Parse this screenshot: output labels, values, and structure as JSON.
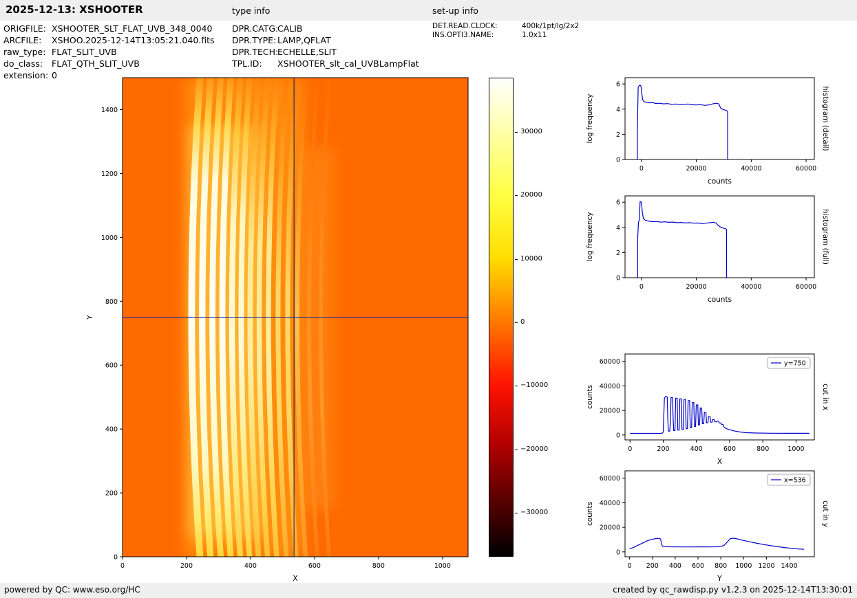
{
  "header": {
    "title": "2025-12-13: XSHOOTER",
    "type_info_label": "type info",
    "setup_info_label": "set-up info"
  },
  "metadata": {
    "left": [
      {
        "label": "ORIGFILE:",
        "value": "XSHOOTER_SLT_FLAT_UVB_348_0040"
      },
      {
        "label": "ARCFILE:",
        "value": "XSHOO.2025-12-14T13:05:21.040.fits"
      },
      {
        "label": "raw_type:",
        "value": "FLAT_SLIT_UVB"
      },
      {
        "label": "do_class:",
        "value": "FLAT_QTH_SLIT_UVB"
      },
      {
        "label": "extension:",
        "value": "0"
      }
    ],
    "middle": [
      {
        "label": "DPR.CATG:",
        "value": "CALIB"
      },
      {
        "label": "DPR.TYPE:",
        "value": "LAMP,QFLAT"
      },
      {
        "label": "DPR.TECH:",
        "value": "ECHELLE,SLIT"
      },
      {
        "label": "TPL.ID:",
        "value": "XSHOOTER_slt_cal_UVBLampFlat"
      }
    ],
    "right": [
      {
        "label": "DET.READ.CLOCK:",
        "value": "400k/1pt/lg/2x2"
      },
      {
        "label": "INS.OPTI3.NAME:",
        "value": "1.0x11"
      }
    ]
  },
  "footer": {
    "left": "powered by QC: www.eso.org/HC",
    "right": "created by qc_rawdisp.py v1.2.3 on 2025-12-14T13:30:01"
  },
  "colorbar": {
    "vmin": -37000,
    "vmax": 38500,
    "ticks": [
      {
        "value": 30000,
        "label": "30000"
      },
      {
        "value": 20000,
        "label": "20000"
      },
      {
        "value": 10000,
        "label": "10000"
      },
      {
        "value": 0,
        "label": "0"
      },
      {
        "value": -10000,
        "label": "−10000"
      },
      {
        "value": -20000,
        "label": "−20000"
      },
      {
        "value": -30000,
        "label": "−30000"
      }
    ],
    "gradient": [
      [
        0,
        "#ffffff"
      ],
      [
        0.113,
        "#ffffa8"
      ],
      [
        0.245,
        "#ffff43"
      ],
      [
        0.377,
        "#ffdd00"
      ],
      [
        0.51,
        "#ff7800"
      ],
      [
        0.642,
        "#ff1300"
      ],
      [
        0.775,
        "#ac0000"
      ],
      [
        0.907,
        "#470000"
      ],
      [
        1,
        "#000000"
      ]
    ]
  },
  "chart_data": [
    {
      "id": "raw-image",
      "type": "heatmap",
      "xlabel": "X",
      "ylabel": "Y",
      "ylabel_off": 44,
      "xlim": [
        0,
        1080
      ],
      "ylim": [
        0,
        1500
      ],
      "xticks": [
        0,
        200,
        400,
        600,
        800,
        1000
      ],
      "yticks": [
        0,
        200,
        400,
        600,
        800,
        1000,
        1200,
        1400
      ],
      "crosshair": {
        "x": 536,
        "y": 750
      },
      "background_color": "#ff6a00",
      "curvature": 26,
      "stripes": [
        {
          "x": 216,
          "w": 21,
          "tone": "w"
        },
        {
          "x": 249,
          "w": 20,
          "tone": "w"
        },
        {
          "x": 281,
          "w": 19,
          "tone": "w"
        },
        {
          "x": 312,
          "w": 19,
          "tone": "w"
        },
        {
          "x": 342,
          "w": 18,
          "tone": "wy"
        },
        {
          "x": 371,
          "w": 17,
          "tone": "wy"
        },
        {
          "x": 399,
          "w": 17,
          "tone": "y"
        },
        {
          "x": 427,
          "w": 16,
          "tone": "y"
        },
        {
          "x": 456,
          "w": 16,
          "tone": "y"
        },
        {
          "x": 486,
          "w": 15,
          "tone": "yo"
        },
        {
          "x": 516,
          "w": 15,
          "tone": "yo"
        },
        {
          "x": 546,
          "w": 14,
          "tone": "o"
        },
        {
          "x": 583,
          "w": 13,
          "tone": "f"
        },
        {
          "x": 620,
          "w": 12,
          "tone": "f"
        }
      ],
      "tones": {
        "w": [
          [
            0,
            "#ff9616"
          ],
          [
            0.1,
            "#ffd94f"
          ],
          [
            0.22,
            "#fffbe0"
          ],
          [
            0.5,
            "#fffff5"
          ],
          [
            0.8,
            "#fff9c8"
          ],
          [
            0.93,
            "#ffe96a"
          ],
          [
            1,
            "#ffd63a"
          ]
        ],
        "wy": [
          [
            0,
            "#ff8d0e"
          ],
          [
            0.12,
            "#ffc93c"
          ],
          [
            0.3,
            "#fff7c0"
          ],
          [
            0.55,
            "#fffbda"
          ],
          [
            0.85,
            "#ffe878"
          ],
          [
            1,
            "#ffd042"
          ]
        ],
        "y": [
          [
            0,
            "#ff830a"
          ],
          [
            0.15,
            "#ffb52e"
          ],
          [
            0.35,
            "#ffe98e"
          ],
          [
            0.6,
            "#ffefa0"
          ],
          [
            0.88,
            "#ffd450"
          ],
          [
            1,
            "#ffbe36"
          ]
        ],
        "yo": [
          [
            0,
            "#ff7a06"
          ],
          [
            0.2,
            "#ffa426"
          ],
          [
            0.45,
            "#ffd866"
          ],
          [
            0.7,
            "#ffd863"
          ],
          [
            1,
            "#ffab2a"
          ]
        ],
        "o": [
          [
            0,
            "#ff7202"
          ],
          [
            0.25,
            "#ff9a20"
          ],
          [
            0.5,
            "#ffc04e"
          ],
          [
            0.8,
            "#ffa830"
          ],
          [
            1,
            "#ff9322"
          ]
        ],
        "f": [
          [
            0,
            "#ff6c00"
          ],
          [
            0.4,
            "#ff8c1c"
          ],
          [
            0.7,
            "#ff9626"
          ],
          [
            1,
            "#ff7a0e"
          ]
        ]
      },
      "glows": [
        {
          "x0": 196,
          "x1": 566,
          "y0": 0,
          "y1": 1500,
          "color": "#ffb41e",
          "opacity": 0.45
        },
        {
          "x0": 205,
          "x1": 440,
          "y0": 60,
          "y1": 1350,
          "color": "#ffd957",
          "opacity": 0.5
        },
        {
          "x0": 560,
          "x1": 660,
          "y0": 150,
          "y1": 1280,
          "color": "#ff8c14",
          "opacity": 0.6
        }
      ]
    },
    {
      "id": "hist-detail",
      "type": "line",
      "xlabel": "counts",
      "ylabel": "log frequency",
      "right_label": "histogram (detail)",
      "xlim": [
        -6000,
        63000
      ],
      "ylim": [
        0,
        6.5
      ],
      "xticks": [
        0,
        20000,
        40000,
        60000
      ],
      "yticks": [
        0,
        2,
        4,
        6
      ],
      "line_color": "#0000cc",
      "points": [
        [
          -1500,
          0
        ],
        [
          -1500,
          2.2
        ],
        [
          -1200,
          5.75
        ],
        [
          -700,
          5.9
        ],
        [
          -200,
          5.85
        ],
        [
          100,
          5.3
        ],
        [
          400,
          4.75
        ],
        [
          900,
          4.6
        ],
        [
          1800,
          4.55
        ],
        [
          2800,
          4.5
        ],
        [
          4000,
          4.52
        ],
        [
          5200,
          4.45
        ],
        [
          6500,
          4.47
        ],
        [
          8000,
          4.42
        ],
        [
          9500,
          4.44
        ],
        [
          11000,
          4.38
        ],
        [
          12500,
          4.41
        ],
        [
          14000,
          4.36
        ],
        [
          15500,
          4.38
        ],
        [
          17000,
          4.41
        ],
        [
          18500,
          4.35
        ],
        [
          20000,
          4.33
        ],
        [
          21500,
          4.36
        ],
        [
          23000,
          4.3
        ],
        [
          24500,
          4.33
        ],
        [
          26000,
          4.42
        ],
        [
          27200,
          4.47
        ],
        [
          28200,
          4.42
        ],
        [
          28800,
          4.1
        ],
        [
          29600,
          3.98
        ],
        [
          30400,
          3.93
        ],
        [
          31000,
          3.88
        ],
        [
          31400,
          3.82
        ],
        [
          31400,
          0
        ]
      ]
    },
    {
      "id": "hist-full",
      "type": "line",
      "xlabel": "counts",
      "ylabel": "log frequency",
      "right_label": "histogram (full)",
      "xlim": [
        -6000,
        63000
      ],
      "ylim": [
        0,
        6.5
      ],
      "xticks": [
        0,
        20000,
        40000,
        60000
      ],
      "yticks": [
        0,
        2,
        4,
        6
      ],
      "line_color": "#0000cc",
      "points": [
        [
          -1400,
          0
        ],
        [
          -1400,
          3.0
        ],
        [
          -1100,
          4.4
        ],
        [
          -800,
          4.6
        ],
        [
          -500,
          6.05
        ],
        [
          0,
          6.0
        ],
        [
          300,
          5.2
        ],
        [
          700,
          4.7
        ],
        [
          1500,
          4.55
        ],
        [
          2500,
          4.5
        ],
        [
          4000,
          4.45
        ],
        [
          5500,
          4.47
        ],
        [
          7000,
          4.42
        ],
        [
          8500,
          4.44
        ],
        [
          10000,
          4.4
        ],
        [
          11500,
          4.42
        ],
        [
          13000,
          4.37
        ],
        [
          14500,
          4.39
        ],
        [
          16000,
          4.35
        ],
        [
          17500,
          4.37
        ],
        [
          19000,
          4.33
        ],
        [
          20500,
          4.35
        ],
        [
          22000,
          4.3
        ],
        [
          23500,
          4.33
        ],
        [
          25000,
          4.37
        ],
        [
          26200,
          4.4
        ],
        [
          27200,
          4.35
        ],
        [
          28000,
          4.15
        ],
        [
          28800,
          4.02
        ],
        [
          29600,
          3.95
        ],
        [
          30400,
          3.9
        ],
        [
          31000,
          3.85
        ],
        [
          31000,
          0
        ]
      ]
    },
    {
      "id": "cut-x",
      "type": "line",
      "legend": "y=750",
      "xlabel": "X",
      "ylabel": "counts",
      "right_label": "cut in x",
      "xlim": [
        -30,
        1110
      ],
      "ylim": [
        -4000,
        66000
      ],
      "xticks": [
        0,
        200,
        400,
        600,
        800,
        1000
      ],
      "yticks": [
        0,
        20000,
        40000,
        60000
      ],
      "line_color": "#0000cc",
      "points": [
        [
          0,
          1300
        ],
        [
          185,
          1300
        ],
        [
          196,
          1600
        ],
        [
          200,
          2500
        ],
        [
          203,
          14000
        ],
        [
          207,
          30000
        ],
        [
          216,
          31500
        ],
        [
          224,
          31000
        ],
        [
          228,
          12000
        ],
        [
          231,
          3200
        ],
        [
          240,
          3200
        ],
        [
          243,
          12000
        ],
        [
          247,
          30500
        ],
        [
          256,
          30500
        ],
        [
          260,
          12000
        ],
        [
          263,
          3600
        ],
        [
          271,
          3600
        ],
        [
          275,
          30000
        ],
        [
          284,
          30000
        ],
        [
          288,
          4000
        ],
        [
          296,
          4000
        ],
        [
          300,
          29500
        ],
        [
          309,
          29500
        ],
        [
          313,
          4600
        ],
        [
          321,
          4600
        ],
        [
          325,
          29000
        ],
        [
          334,
          29000
        ],
        [
          338,
          5200
        ],
        [
          346,
          5200
        ],
        [
          350,
          28000
        ],
        [
          359,
          28000
        ],
        [
          363,
          6000
        ],
        [
          371,
          6000
        ],
        [
          375,
          26500
        ],
        [
          384,
          26500
        ],
        [
          388,
          7000
        ],
        [
          395,
          7000
        ],
        [
          399,
          24500
        ],
        [
          408,
          24500
        ],
        [
          412,
          8200
        ],
        [
          419,
          8200
        ],
        [
          423,
          22000
        ],
        [
          432,
          22000
        ],
        [
          436,
          9200
        ],
        [
          444,
          9200
        ],
        [
          448,
          18500
        ],
        [
          457,
          18500
        ],
        [
          461,
          10000
        ],
        [
          469,
          10000
        ],
        [
          473,
          15000
        ],
        [
          482,
          15000
        ],
        [
          486,
          10500
        ],
        [
          494,
          10500
        ],
        [
          498,
          12500
        ],
        [
          507,
          12500
        ],
        [
          511,
          10800
        ],
        [
          520,
          10800
        ],
        [
          524,
          11300
        ],
        [
          533,
          11300
        ],
        [
          537,
          9800
        ],
        [
          547,
          9800
        ],
        [
          552,
          8600
        ],
        [
          560,
          8600
        ],
        [
          566,
          6500
        ],
        [
          580,
          5200
        ],
        [
          600,
          4300
        ],
        [
          630,
          3200
        ],
        [
          660,
          2500
        ],
        [
          700,
          1900
        ],
        [
          760,
          1600
        ],
        [
          850,
          1450
        ],
        [
          950,
          1400
        ],
        [
          1080,
          1400
        ]
      ]
    },
    {
      "id": "cut-y",
      "type": "line",
      "legend": "x=536",
      "xlabel": "Y",
      "ylabel": "counts",
      "right_label": "cut in y",
      "xlim": [
        -40,
        1620
      ],
      "ylim": [
        -4000,
        66000
      ],
      "xticks": [
        0,
        200,
        400,
        600,
        800,
        1000,
        1200,
        1400
      ],
      "yticks": [
        0,
        20000,
        40000,
        60000
      ],
      "line_color": "#0000cc",
      "points": [
        [
          0,
          2600
        ],
        [
          30,
          3400
        ],
        [
          70,
          5200
        ],
        [
          110,
          7000
        ],
        [
          150,
          8800
        ],
        [
          190,
          10100
        ],
        [
          230,
          10800
        ],
        [
          262,
          11000
        ],
        [
          272,
          10400
        ],
        [
          280,
          6500
        ],
        [
          288,
          4600
        ],
        [
          300,
          4300
        ],
        [
          350,
          4100
        ],
        [
          450,
          4000
        ],
        [
          550,
          4000
        ],
        [
          650,
          4050
        ],
        [
          750,
          4100
        ],
        [
          800,
          4300
        ],
        [
          830,
          5400
        ],
        [
          858,
          8200
        ],
        [
          882,
          10600
        ],
        [
          900,
          11100
        ],
        [
          925,
          10900
        ],
        [
          960,
          10200
        ],
        [
          1000,
          9300
        ],
        [
          1060,
          8100
        ],
        [
          1120,
          6900
        ],
        [
          1180,
          5900
        ],
        [
          1240,
          5000
        ],
        [
          1300,
          4200
        ],
        [
          1360,
          3500
        ],
        [
          1420,
          2900
        ],
        [
          1480,
          2400
        ],
        [
          1530,
          2100
        ]
      ]
    }
  ]
}
